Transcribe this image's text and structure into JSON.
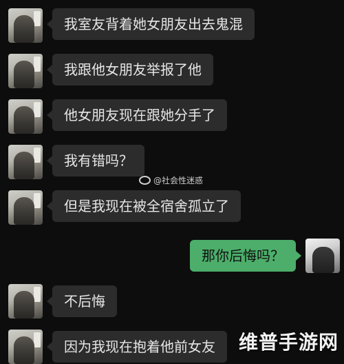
{
  "messages": [
    {
      "side": "left",
      "text": "我室友背着她女朋友出去鬼混"
    },
    {
      "side": "left",
      "text": "我跟他女朋友举报了他"
    },
    {
      "side": "left",
      "text": "他女朋友现在跟她分手了"
    },
    {
      "side": "left",
      "text": "我有错吗？"
    },
    {
      "side": "left",
      "text": "但是我现在被全宿舍孤立了"
    },
    {
      "side": "right",
      "text": "那你后悔吗？"
    },
    {
      "side": "left",
      "text": "不后悔"
    },
    {
      "side": "left",
      "text": "因为我现在抱着他前女友"
    }
  ],
  "watermark": {
    "text": "@社会性迷惑",
    "icon": "weibo-icon"
  },
  "brand": {
    "text": "维普手游网"
  },
  "colors": {
    "background": "#0d0d0d",
    "bubble_other": "#2c2c2c",
    "bubble_mine": "#4cae6a"
  }
}
